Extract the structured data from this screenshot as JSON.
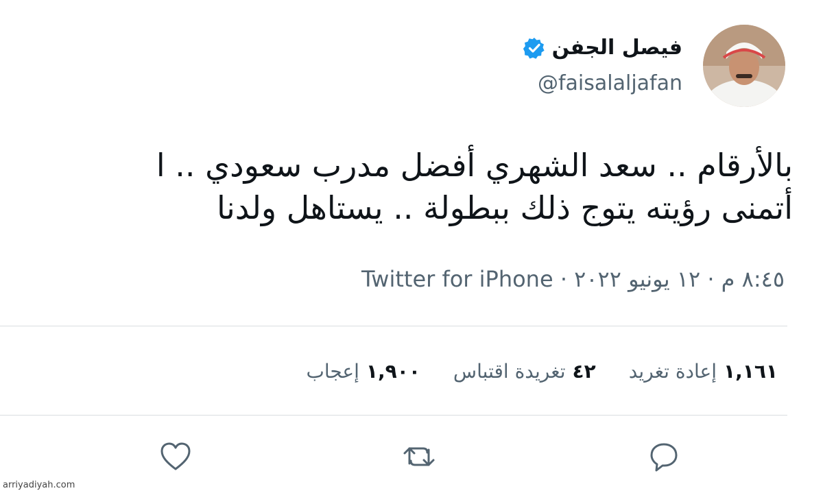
{
  "author": {
    "display_name": "فيصل الجفن",
    "handle": "@faisalaljafan"
  },
  "tweet": {
    "lines": [
      "بالأرقام .. سعد الشهري أفضل مدرب سعودي .. ا",
      "أتمنى رؤيته يتوج ذلك ببطولة .. يستاهل ولدنا"
    ]
  },
  "meta": {
    "time": "٨:٤٥ م",
    "separator": "·",
    "date": "١٢ يونيو ٢٠٢٢",
    "source": "Twitter for iPhone"
  },
  "stats": {
    "retweets_value": "١,١٦١",
    "retweets_label": "إعادة تغريد",
    "quotes_value": "٤٢",
    "quotes_label": "تغريدة اقتباس",
    "likes_value": "١,٩٠٠",
    "likes_label": "إعجاب"
  },
  "actions": {
    "reply_icon": "speech-bubble-icon",
    "retweet_icon": "retweet-arrows-icon",
    "like_icon": "heart-icon"
  },
  "colors": {
    "text": "#0f1419",
    "secondary": "#536471",
    "verified": "#1d9bf0",
    "divider": "#d9dde0"
  },
  "watermark": "arriyadiyah.com"
}
